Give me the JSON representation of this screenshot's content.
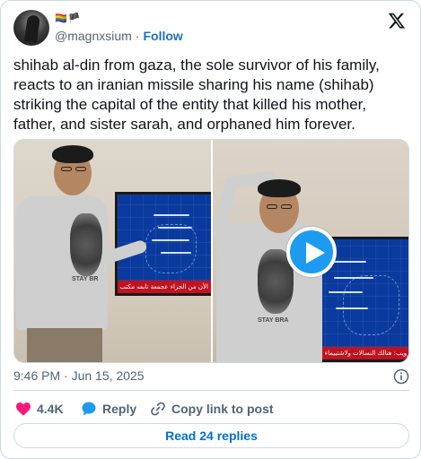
{
  "author": {
    "emoji_line": "🏳️‍🌈🏴",
    "handle": "@magnxsium",
    "separator": "·",
    "follow_label": "Follow"
  },
  "tweet": {
    "text": "shihab al-din from gaza, the sole survivor of his family, reacts to an iranian missile sharing his name (shihab) striking the capital of the entity that killed his mother, father, and sister sarah, and orphaned him forever."
  },
  "media": {
    "ticker_left": "الأن من الجزاء عجمعة تابعه مكتب الأنظار قبل العاشر",
    "ticker_right": "ترويب: هنالك النسالات ولاشتبيماء عجمعة فطر",
    "shirt_text_left": "STAY BR",
    "shirt_text_right": "STAY BRA"
  },
  "meta": {
    "timestamp": "9:46 PM · Jun 15, 2025"
  },
  "actions": {
    "like_count": "4.4K",
    "reply_label": "Reply",
    "copy_label": "Copy link to post"
  },
  "read_replies_label": "Read 24 replies",
  "colors": {
    "accent": "#1d9bf0",
    "link": "#006fd6",
    "like": "#f91880",
    "muted": "#536471",
    "border": "#cfd9de"
  },
  "icons": [
    "x-logo-icon",
    "play-icon",
    "info-icon",
    "heart-icon",
    "reply-bubble-icon",
    "link-icon"
  ]
}
